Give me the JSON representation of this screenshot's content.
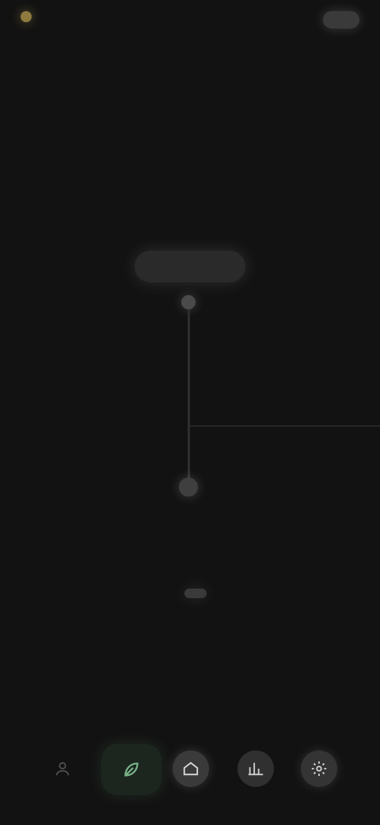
{
  "topbar": {
    "left_label": "",
    "right_label": ""
  },
  "header": {
    "title": "",
    "subtitle": ""
  },
  "graph": {
    "top_node_label": ""
  },
  "readout": {
    "label": "",
    "value": "",
    "sub": ""
  },
  "bottom_nav": {
    "items": [
      {
        "icon": "person-icon"
      },
      {
        "icon": "leaf-icon",
        "active": true
      },
      {
        "icon": "home-icon"
      },
      {
        "icon": "chart-icon"
      },
      {
        "icon": "settings-icon"
      }
    ]
  },
  "colors": {
    "background": "#121212",
    "accent": "#7bb58a",
    "status": "#8e7a3e"
  }
}
